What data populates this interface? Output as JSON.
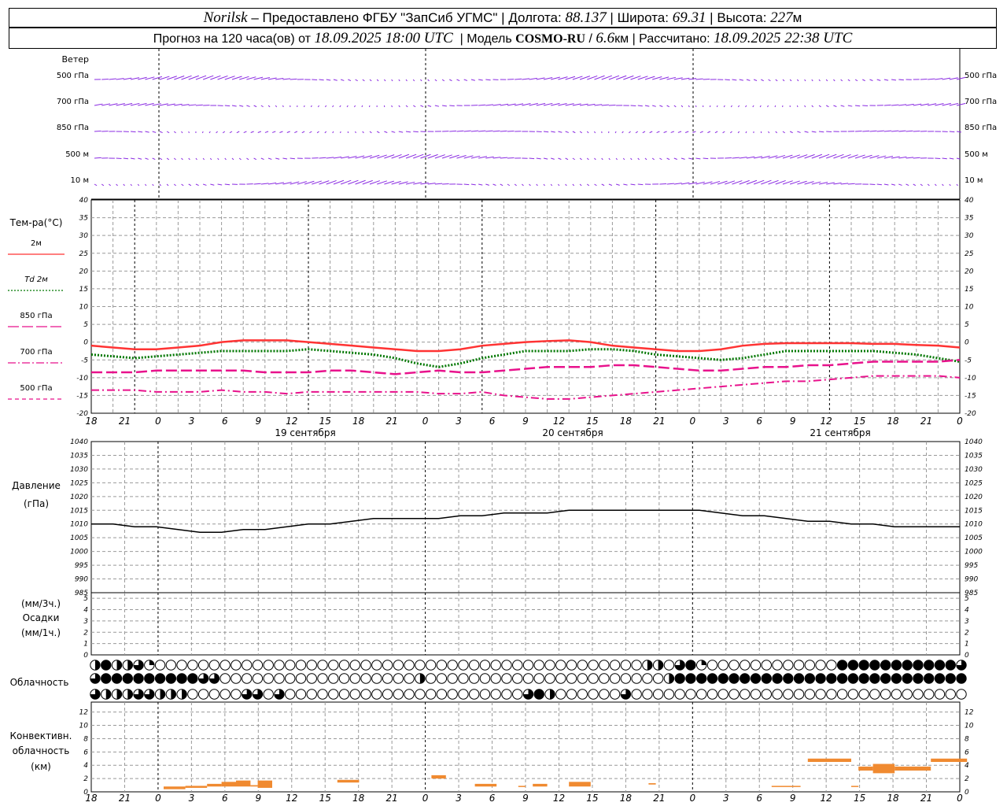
{
  "header": {
    "station": "Norilsk",
    "provider": "– Предоставлено ФГБУ \"ЗапСиб УГМС\"",
    "lon_label": "Долгота:",
    "lon": "88.137",
    "lat_label": "Широта:",
    "lat": "69.31",
    "alt_label": "Высота:",
    "alt": "227",
    "alt_unit": "м",
    "forecast_prefix": "Прогноз на 120 часа(ов) от",
    "forecast_start": "18.09.2025 18:00 UTC",
    "model_label": "Модель",
    "model_name": "COSMO-RU",
    "model_res": "6.6",
    "model_unit": "км",
    "calc_label": "Рассчитано:",
    "calc_time": "18.09.2025 22:38 UTC"
  },
  "x_axis": {
    "hour_labels": [
      "18",
      "21",
      "0",
      "3",
      "6",
      "9",
      "12",
      "15",
      "18",
      "21",
      "0",
      "3",
      "6",
      "9",
      "12",
      "15",
      "18",
      "21",
      "0",
      "3",
      "6",
      "9",
      "12",
      "15",
      "18",
      "21",
      "0"
    ],
    "day_labels": [
      "19 сентября",
      "20 сентября",
      "21 сентября"
    ]
  },
  "wind_panel": {
    "title": "Ветер",
    "levels": [
      "500 гПа",
      "700 гПа",
      "850 гПа",
      "500 м",
      "10 м"
    ]
  },
  "temp_panel": {
    "title": "Тем-ра(°C)",
    "legend": [
      {
        "label": "2м",
        "color": "#ff3333",
        "dash": "solid"
      },
      {
        "label": "Td  2м",
        "color": "#007700",
        "dash": "dotted"
      },
      {
        "label": "850 гПа",
        "color": "#e8128c",
        "dash": "long"
      },
      {
        "label": "700 гПа",
        "color": "#e8128c",
        "dash": "dashdot"
      },
      {
        "label": "500 гПа",
        "color": "#e8128c",
        "dash": "dash"
      }
    ],
    "ticks": [
      "40",
      "35",
      "30",
      "25",
      "20",
      "15",
      "10",
      "5",
      "0",
      "-5",
      "-10",
      "-15",
      "-20"
    ]
  },
  "pressure_panel": {
    "title": "Давление",
    "unit": "(гПа)",
    "ticks": [
      "1040",
      "1035",
      "1030",
      "1025",
      "1020",
      "1015",
      "1010",
      "1005",
      "1000",
      "995",
      "990",
      "985"
    ]
  },
  "precip_panel": {
    "unit_top": "(мм/3ч.)",
    "title": "Осадки",
    "unit_bottom": "(мм/1ч.)",
    "ticks": [
      "5",
      "4",
      "3",
      "2",
      "1",
      "0"
    ]
  },
  "cloud_panel": {
    "title": "Облачность"
  },
  "conv_panel": {
    "title_1": "Конвективн.",
    "title_2": "облачность",
    "unit": "(км)",
    "ticks": [
      "12",
      "10",
      "8",
      "6",
      "4",
      "2",
      "0"
    ]
  },
  "chart_data": {
    "type": "line",
    "x_hours_from_start": [
      0,
      3,
      6,
      9,
      12,
      15,
      18,
      21,
      24,
      27,
      30,
      33,
      36,
      39,
      42,
      45,
      48,
      51,
      54,
      57,
      60,
      63,
      66,
      69,
      72,
      75,
      78,
      81,
      84,
      87,
      90,
      93,
      96,
      99,
      102,
      105,
      108,
      111,
      114,
      117,
      120
    ],
    "series": [
      {
        "name": "2м",
        "values": [
          -1,
          -1.5,
          -2,
          -2,
          -1.5,
          -1,
          0,
          0.5,
          0.5,
          0.5,
          0,
          -0.5,
          -1,
          -1.5,
          -2,
          -2.5,
          -2.5,
          -2,
          -1,
          -0.5,
          0,
          0.3,
          0.5,
          0,
          -1,
          -1.5,
          -2,
          -2.5,
          -2.5,
          -2,
          -1,
          -0.5,
          -0.3,
          -0.3,
          -0.3,
          -0.3,
          -0.5,
          -0.5,
          -0.8,
          -1,
          -1.5
        ]
      },
      {
        "name": "Td  2м",
        "values": [
          -3.5,
          -4,
          -4.5,
          -4,
          -3.5,
          -3,
          -2.5,
          -2.5,
          -2.5,
          -2.5,
          -2,
          -2.5,
          -3,
          -3.5,
          -4.5,
          -6,
          -7,
          -6,
          -4.5,
          -3.5,
          -2.5,
          -2.5,
          -2.5,
          -2,
          -2,
          -2.5,
          -3.5,
          -4,
          -4.5,
          -5,
          -4.5,
          -3.5,
          -2.5,
          -2.5,
          -2.5,
          -2.5,
          -2.5,
          -3,
          -3.5,
          -4.5,
          -5.5
        ]
      },
      {
        "name": "850 гПа",
        "values": [
          -8.5,
          -8.5,
          -8.5,
          -8,
          -8,
          -8,
          -8,
          -8,
          -8.5,
          -8.5,
          -8.5,
          -8,
          -8,
          -8.5,
          -9,
          -8.5,
          -8,
          -8.5,
          -8.5,
          -8,
          -7.5,
          -7,
          -7,
          -7,
          -6.5,
          -6.5,
          -7,
          -7.5,
          -8,
          -8,
          -7.5,
          -7,
          -7,
          -6.5,
          -6.5,
          -6,
          -5.5,
          -5.5,
          -5.5,
          -5.5,
          -5
        ]
      },
      {
        "name": "700 гПа",
        "values": [
          -13.5,
          -13.5,
          -13.5,
          -14,
          -14,
          -14,
          -13.5,
          -14,
          -14,
          -14.5,
          -14,
          -14,
          -14,
          -14,
          -14,
          -14,
          -14.5,
          -14.5,
          -14,
          -15,
          -15.5,
          -16,
          -16,
          -15.5,
          -15,
          -14.5,
          -14,
          -13.5,
          -13,
          -12.5,
          -12,
          -11.5,
          -11,
          -11,
          -10.5,
          -10,
          -9.5,
          -9.5,
          -9.5,
          -9.5,
          -10
        ]
      },
      {
        "name": "Давление",
        "values": [
          1010,
          1010,
          1009,
          1009,
          1008,
          1007,
          1007,
          1008,
          1008,
          1009,
          1010,
          1010,
          1011,
          1012,
          1012,
          1012,
          1012,
          1013,
          1013,
          1014,
          1014,
          1014,
          1015,
          1015,
          1015,
          1015,
          1015,
          1015,
          1015,
          1014,
          1013,
          1013,
          1012,
          1011,
          1011,
          1010,
          1010,
          1009,
          1009,
          1009,
          1009
        ]
      }
    ],
    "temp_ylim": [
      -20,
      40
    ],
    "pressure_ylim": [
      985,
      1040
    ],
    "precip_ylim": [
      0,
      5
    ],
    "conv_ylim": [
      0,
      13
    ],
    "grid": true,
    "cloud_cover_octas": {
      "row1": [
        4,
        8,
        8,
        4,
        4,
        6,
        6,
        3,
        0,
        0,
        0,
        0,
        0,
        0,
        0,
        0,
        0,
        0,
        0,
        0,
        0,
        0,
        0,
        0,
        0,
        0,
        0,
        0,
        0,
        0,
        0,
        0,
        0,
        0,
        0,
        0,
        0,
        0,
        0,
        0,
        0,
        0,
        0,
        0,
        0,
        0,
        0,
        0,
        0,
        0,
        0,
        0,
        0,
        0,
        0,
        0,
        0,
        0,
        0,
        0,
        0,
        0,
        0,
        0,
        0,
        0,
        0,
        0,
        0,
        0,
        0,
        0,
        0,
        0,
        0,
        0,
        0,
        0,
        0,
        0,
        0,
        4,
        4,
        0,
        0,
        4,
        6,
        8,
        6,
        3,
        0,
        0,
        0,
        0,
        0,
        0,
        0,
        0,
        0,
        0,
        0,
        0,
        0,
        0,
        0,
        0,
        0,
        0,
        0,
        8,
        8,
        8,
        8,
        8,
        8,
        6,
        8,
        8,
        8,
        8,
        8,
        8,
        8,
        6,
        8,
        8,
        8,
        6,
        6
      ],
      "row2": [
        6,
        8,
        8,
        8,
        8,
        8,
        8,
        8,
        8,
        8,
        8,
        8,
        8,
        8,
        8,
        6,
        6,
        3,
        0,
        0,
        0,
        0,
        0,
        0,
        0,
        0,
        0,
        0,
        0,
        0,
        0,
        0,
        0,
        0,
        0,
        0,
        0,
        0,
        0,
        0,
        0,
        0,
        0,
        0,
        0,
        4,
        4,
        0,
        0,
        0,
        0,
        0,
        0,
        0,
        0,
        0,
        0,
        0,
        0,
        0,
        0,
        0,
        0,
        0,
        0,
        0,
        0,
        0,
        0,
        0,
        0,
        0,
        0,
        0,
        0,
        0,
        0,
        0,
        0,
        0,
        0,
        4,
        6,
        8,
        8,
        6,
        8,
        8,
        8,
        8,
        8,
        8,
        8,
        8,
        8,
        8,
        8,
        8,
        8,
        8,
        8,
        8,
        8,
        8,
        8,
        8,
        8,
        8,
        8,
        8,
        8,
        8,
        8,
        8,
        8,
        8,
        8,
        8,
        8,
        8,
        8,
        8,
        8,
        8,
        8
      ],
      "row3": [
        6,
        4,
        4,
        4,
        4,
        6,
        6,
        6,
        4,
        4,
        6,
        4,
        4,
        0,
        0,
        0,
        0,
        0,
        0,
        0,
        0,
        0,
        6,
        6,
        0,
        0,
        6,
        6,
        0,
        0,
        0,
        0,
        0,
        0,
        0,
        0,
        0,
        0,
        0,
        0,
        0,
        0,
        0,
        0,
        0,
        0,
        0,
        0,
        0,
        0,
        0,
        0,
        0,
        0,
        0,
        0,
        0,
        0,
        0,
        0,
        0,
        0,
        0,
        6,
        8,
        8,
        4,
        0,
        0,
        0,
        0,
        0,
        0,
        0,
        0,
        0,
        0,
        6,
        6,
        0,
        0,
        0,
        0,
        0,
        0,
        0,
        0,
        0,
        0,
        0,
        0,
        0,
        0,
        0,
        0,
        0,
        0,
        0,
        0,
        0,
        0,
        0,
        0,
        0,
        0,
        0,
        0,
        0,
        0,
        0,
        0,
        0,
        0,
        0,
        0,
        0,
        0,
        0,
        0,
        0,
        0,
        0,
        0,
        0,
        0,
        0,
        0,
        0,
        0
      ]
    },
    "convective_cloud_km": [
      {
        "start_h": 10,
        "end_h": 13,
        "base": 0.4,
        "top": 0.8
      },
      {
        "start_h": 13,
        "end_h": 16,
        "base": 0.6,
        "top": 0.9
      },
      {
        "start_h": 16,
        "end_h": 18,
        "base": 0.8,
        "top": 1.2
      },
      {
        "start_h": 18,
        "end_h": 20,
        "base": 0.8,
        "top": 1.5
      },
      {
        "start_h": 20,
        "end_h": 22,
        "base": 0.8,
        "top": 1.7
      },
      {
        "start_h": 22,
        "end_h": 23,
        "base": 0.8,
        "top": 1.0
      },
      {
        "start_h": 23,
        "end_h": 25,
        "base": 0.6,
        "top": 1.7
      },
      {
        "start_h": 34,
        "end_h": 37,
        "base": 1.4,
        "top": 1.8
      },
      {
        "start_h": 47,
        "end_h": 49,
        "base": 2.0,
        "top": 2.5
      },
      {
        "start_h": 53,
        "end_h": 56,
        "base": 0.8,
        "top": 1.2
      },
      {
        "start_h": 59,
        "end_h": 60,
        "base": 0.8,
        "top": 0.9
      },
      {
        "start_h": 61,
        "end_h": 63,
        "base": 0.8,
        "top": 1.2
      },
      {
        "start_h": 66,
        "end_h": 69,
        "base": 0.8,
        "top": 1.5
      },
      {
        "start_h": 77,
        "end_h": 78,
        "base": 1.1,
        "top": 1.3
      },
      {
        "start_h": 94,
        "end_h": 98,
        "base": 0.8,
        "top": 0.9
      },
      {
        "start_h": 99,
        "end_h": 105,
        "base": 4.5,
        "top": 5.0
      },
      {
        "start_h": 105,
        "end_h": 106,
        "base": 0.8,
        "top": 0.9
      },
      {
        "start_h": 106,
        "end_h": 108,
        "base": 3.2,
        "top": 3.8
      },
      {
        "start_h": 108,
        "end_h": 111,
        "base": 2.8,
        "top": 4.2
      },
      {
        "start_h": 111,
        "end_h": 116,
        "base": 3.2,
        "top": 3.8
      },
      {
        "start_h": 116,
        "end_h": 121,
        "base": 4.5,
        "top": 5.0
      }
    ]
  }
}
